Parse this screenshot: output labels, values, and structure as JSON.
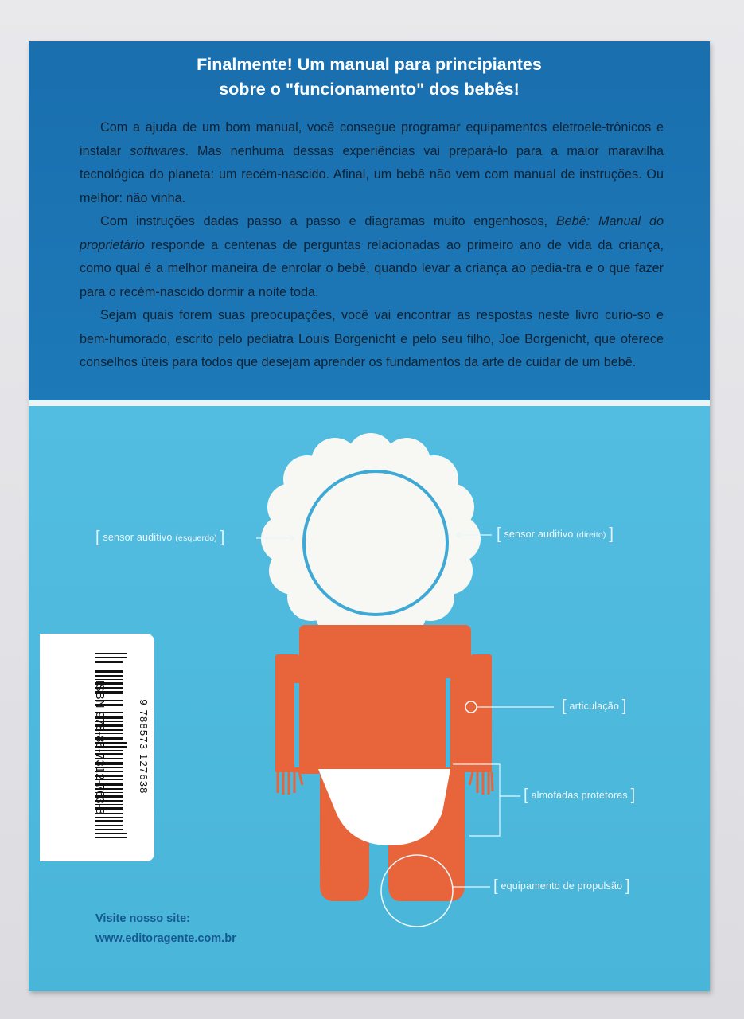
{
  "cover": {
    "headline_line1": "Finalmente! Um manual para principiantes",
    "headline_line2": "sobre o \"funcionamento\" dos bebês!",
    "paragraph1_a": "Com a ajuda de um bom manual, você consegue programar equipamentos eletroele-trônicos e instalar ",
    "paragraph1_b": "softwares",
    "paragraph1_c": ". Mas nenhuma dessas experiências vai prepará-lo para a maior maravilha tecnológica do planeta: um recém-nascido. Afinal, um bebê não vem com manual de instruções. Ou melhor: não vinha.",
    "paragraph2_a": "Com instruções dadas passo a passo e diagramas muito engenhosos, ",
    "paragraph2_b": "Bebê: Manual do proprietário",
    "paragraph2_c": " responde a centenas de perguntas relacionadas ao primeiro ano de vida da criança, como qual é a melhor maneira de enrolar o bebê, quando levar a criança ao pedia-tra e o que fazer para o recém-nascido dormir a noite toda.",
    "paragraph3": "Sejam quais forem suas preocupações, você vai encontrar as respostas neste livro curio-so e bem-humorado, escrito pelo pediatra Louis Borgenicht e pelo seu filho, Joe Borgenicht, que oferece conselhos úteis para todos que desejam aprender os fundamentos da arte de cuidar de um bebê."
  },
  "diagram": {
    "left_ear_label": "sensor auditivo",
    "left_ear_side": "(esquerdo)",
    "right_ear_label": "sensor auditivo",
    "right_ear_side": "(direito)",
    "joint_label": "articulação",
    "pads_label": "almofadas protetoras",
    "propulsion_label": "equipamento de propulsão"
  },
  "barcode": {
    "isbn": "ISBN 978-85-7312-763-8",
    "ean_digits": "9 788573 127638"
  },
  "site": {
    "line1": "Visite nosso site:",
    "line2": "www.editoragente.com.br"
  },
  "colors": {
    "top_panel": "#1d79b8",
    "lower_panel": "#4ab8dc",
    "baby_body": "#e8643a",
    "diaper": "#ffffff"
  }
}
